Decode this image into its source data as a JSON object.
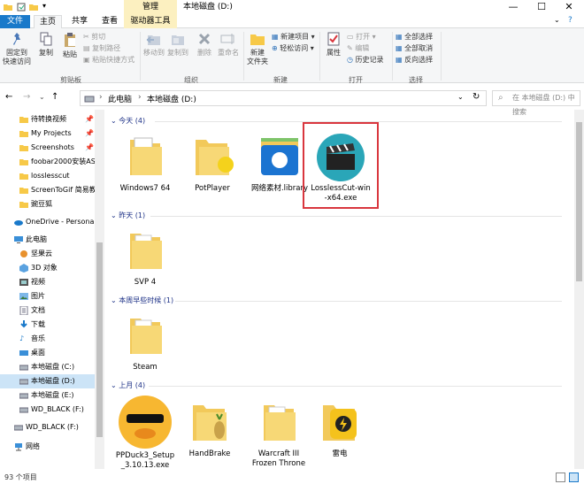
{
  "titlebar": {
    "manage": "管理",
    "title": "本地磁盘 (D:)",
    "min": "—",
    "max": "☐",
    "close": "✕"
  },
  "tabs": {
    "file": "文件",
    "home": "主页",
    "share": "共享",
    "view": "查看",
    "drive": "驱动器工具"
  },
  "ribbon": {
    "pin": "固定到\n快速访问",
    "copy": "复制",
    "paste": "粘贴",
    "cut": "剪切",
    "copy_path": "复制路径",
    "paste_shortcut": "粘贴快捷方式",
    "move_to": "移动到",
    "copy_to": "复制到",
    "delete": "删除",
    "rename": "重命名",
    "new_item": "新建项目",
    "easy_access": "轻松访问",
    "new_folder": "新建\n文件夹",
    "properties": "属性",
    "open": "打开",
    "edit": "编辑",
    "history": "历史记录",
    "select_all": "全部选择",
    "select_none": "全部取消",
    "invert": "反向选择",
    "g_clipboard": "剪贴板",
    "g_organize": "组织",
    "g_new": "新建",
    "g_open": "打开",
    "g_select": "选择"
  },
  "address": {
    "crumb1": "此电脑",
    "crumb2": "本地磁盘 (D:)",
    "search_placeholder": "在 本地磁盘 (D:) 中搜索"
  },
  "nav": [
    {
      "label": "待转换视频",
      "pinned": true
    },
    {
      "label": "My Projects",
      "pinned": true
    },
    {
      "label": "Screenshots",
      "pinned": true
    },
    {
      "label": "foobar2000安装AS",
      "pinned": false
    },
    {
      "label": "losslesscut",
      "pinned": false
    },
    {
      "label": "ScreenToGif 简易教",
      "pinned": false
    },
    {
      "label": "豌豆狐",
      "pinned": false
    },
    {
      "label": "OneDrive - Personal"
    },
    {
      "label": "此电脑"
    },
    {
      "label": "坚果云"
    },
    {
      "label": "3D 对象"
    },
    {
      "label": "视频"
    },
    {
      "label": "图片"
    },
    {
      "label": "文档"
    },
    {
      "label": "下载"
    },
    {
      "label": "音乐"
    },
    {
      "label": "桌面"
    },
    {
      "label": "本地磁盘 (C:)"
    },
    {
      "label": "本地磁盘 (D:)"
    },
    {
      "label": "本地磁盘 (E:)"
    },
    {
      "label": "WD_BLACK (F:)"
    },
    {
      "label": "WD_BLACK (F:)"
    },
    {
      "label": "网络"
    }
  ],
  "groups": {
    "today": "今天 (4)",
    "yesterday": "昨天 (1)",
    "earlier_week": "本周早些时候 (1)",
    "last_month": "上月 (4)"
  },
  "files": {
    "win7": "Windows7 64",
    "potplayer": "PotPlayer",
    "library": "网络素材.library",
    "lossless": "LosslessCut-win\n-x64.exe",
    "svp": "SVP 4",
    "steam": "Steam",
    "ppduck": "PPDuck3_Setup\n_3.10.13.exe",
    "handbrake": "HandBrake",
    "warcraft": "Warcraft III\nFrozen Throne",
    "leidian": "雷电"
  },
  "status": {
    "count": "93 个项目"
  }
}
